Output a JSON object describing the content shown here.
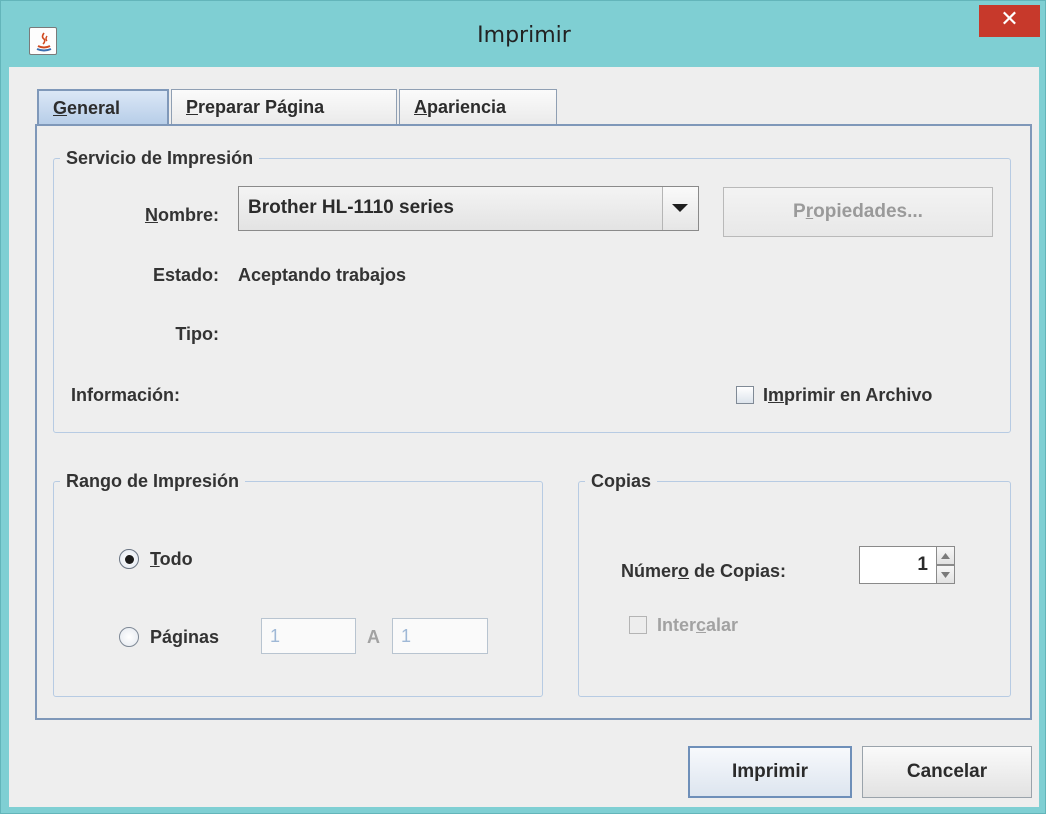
{
  "window": {
    "title": "Imprimir",
    "close_glyph": "✕",
    "app_icon": "java-icon",
    "accent_color": "#7fcfd3",
    "close_color": "#c7392b"
  },
  "tabs": [
    {
      "pre": "",
      "mnemonic": "G",
      "post": "eneral",
      "active": true
    },
    {
      "pre": "",
      "mnemonic": "P",
      "post": "reparar Página",
      "active": false
    },
    {
      "pre": "",
      "mnemonic": "A",
      "post": "pariencia",
      "active": false
    }
  ],
  "print_service": {
    "title": "Servicio de Impresión",
    "name_label_pre": "",
    "name_label_mnemonic": "N",
    "name_label_post": "ombre:",
    "printer_selected": "Brother HL-1110 series",
    "properties_pre": "P",
    "properties_mnemonic": "r",
    "properties_post": "opiedades...",
    "properties_enabled": false,
    "status_label": "Estado:",
    "status_value": "Aceptando trabajos",
    "type_label": "Tipo:",
    "type_value": "",
    "info_label": "Información:",
    "info_value": "",
    "print_to_file_pre": "I",
    "print_to_file_mnemonic": "m",
    "print_to_file_post": "primir en Archivo",
    "print_to_file_checked": false
  },
  "print_range": {
    "title": "Rango de Impresión",
    "all_pre": "",
    "all_mnemonic": "T",
    "all_post": "odo",
    "all_selected": true,
    "pages_pre": "Pá",
    "pages_mnemonic": "g",
    "pages_post": "inas",
    "pages_selected": false,
    "from_value": "1",
    "to_label": "A",
    "to_value": "1"
  },
  "copies": {
    "title": "Copias",
    "count_label_pre": "Númer",
    "count_label_mnemonic": "o",
    "count_label_post": " de Copias:",
    "count_value": "1",
    "collate_pre": "Inter",
    "collate_mnemonic": "c",
    "collate_post": "alar",
    "collate_checked": false,
    "collate_enabled": false
  },
  "buttons": {
    "print_label": "Imprimir",
    "cancel_label": "Cancelar"
  }
}
